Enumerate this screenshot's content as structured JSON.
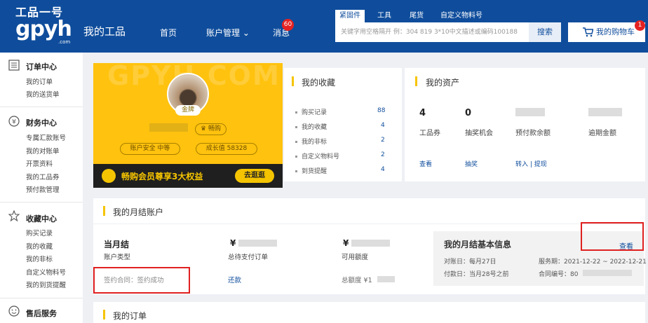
{
  "header": {
    "logo_top": "工品一号",
    "logo_main": "gpyh",
    "logo_sub": ".com",
    "site_title": "我的工品",
    "nav": [
      {
        "label": "首页"
      },
      {
        "label": "账户管理 ⌄"
      },
      {
        "label": "消息"
      }
    ],
    "message_badge": "60",
    "search_tabs": [
      "紧固件",
      "工具",
      "尾货",
      "自定义物料号"
    ],
    "search_placeholder": "关键字用空格隔开 例：304 819 3*10中文描述或编码100188",
    "search_button": "搜索",
    "cart_label": "我的购物车",
    "cart_badge": "1"
  },
  "sidebar": {
    "groups": [
      {
        "title": "订单中心",
        "icon": "list-icon",
        "items": [
          "我的订单",
          "我的送货单"
        ]
      },
      {
        "title": "财务中心",
        "icon": "yen-icon",
        "items": [
          "专属汇款账号",
          "我的对账单",
          "开票资料",
          "我的工品券",
          "预付款管理"
        ]
      },
      {
        "title": "收藏中心",
        "icon": "star-icon",
        "items": [
          "购买记录",
          "我的收藏",
          "我的非标",
          "自定义物料号",
          "我的到货提醒"
        ]
      },
      {
        "title": "售后服务",
        "icon": "smile-icon",
        "items": []
      }
    ]
  },
  "member_card": {
    "watermark": "GPYH.COM",
    "level": "金牌",
    "badge": "畅购",
    "security": "账户安全  中等",
    "growth": "成长值  58328",
    "promo_text": "畅购会员尊享3大权益",
    "promo_button": "去逛逛"
  },
  "favorites": {
    "title": "我的收藏",
    "rows": [
      {
        "label": "购买记录",
        "count": "88"
      },
      {
        "label": "我的收藏",
        "count": "4"
      },
      {
        "label": "我的非标",
        "count": "2"
      },
      {
        "label": "自定义物料号",
        "count": "2"
      },
      {
        "label": "到货提醒",
        "count": "4"
      }
    ]
  },
  "assets": {
    "title": "我的资产",
    "items": [
      {
        "value": "4",
        "label": "工品券",
        "link": "查看"
      },
      {
        "value": "0",
        "label": "抽奖机会",
        "link": "抽奖"
      },
      {
        "value": "",
        "label": "预付款余额",
        "link": "转入 | 提现"
      },
      {
        "value": "",
        "label": "逾期金额",
        "link": ""
      }
    ]
  },
  "monthly": {
    "title": "我的月结账户",
    "type_value": "当月结",
    "type_label": "账户类型",
    "contract": "签约合同：签约成功",
    "pending_symbol": "¥",
    "pending_label": "总待支付订单",
    "repay_link": "还款",
    "available_symbol": "¥",
    "available_label": "可用额度",
    "total_label": "总额度 ¥1",
    "info_title": "我的月结基本信息",
    "info_link": "查看",
    "info_rows": [
      "对账日：每月27日",
      "服务期：2021-12-22 ~ 2022-12-21",
      "付款日：当月28号之前",
      "合同编号：80"
    ]
  },
  "orders": {
    "title": "我的订单"
  }
}
